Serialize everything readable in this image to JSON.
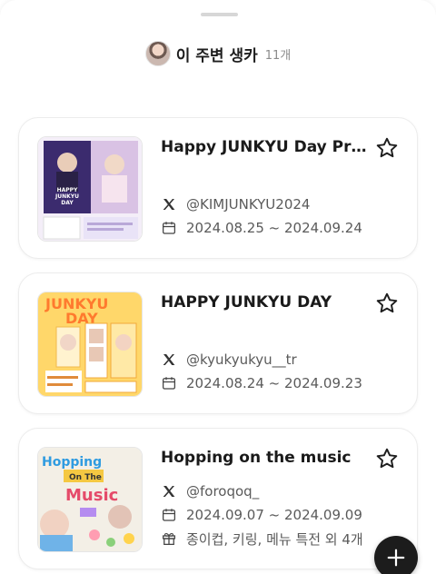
{
  "header": {
    "title": "이 주변 생카",
    "count": "11개"
  },
  "cards": [
    {
      "title": "Happy JUNKYU Day Proj…",
      "handle": "@KIMJUNKYU2024",
      "dates": "2024.08.25 ~ 2024.09.24",
      "poster_text": "HAPPY JUNKYU DAY"
    },
    {
      "title": "HAPPY JUNKYU DAY",
      "handle": "@kyukyukyu__tr",
      "dates": "2024.08.24 ~ 2024.09.23",
      "poster_text": "JUNKYU DAY"
    },
    {
      "title": "Hopping on the music",
      "handle": "@foroqoq_",
      "dates": "2024.09.07 ~ 2024.09.09",
      "benefits": "종이컵, 키링, 메뉴 특전 외 4개",
      "poster_text": "Hopping On The Music"
    }
  ],
  "icons": {
    "star": "star-outline-icon",
    "x": "x-logo-icon",
    "calendar": "calendar-icon",
    "gift": "gift-icon",
    "plus": "plus-icon"
  }
}
